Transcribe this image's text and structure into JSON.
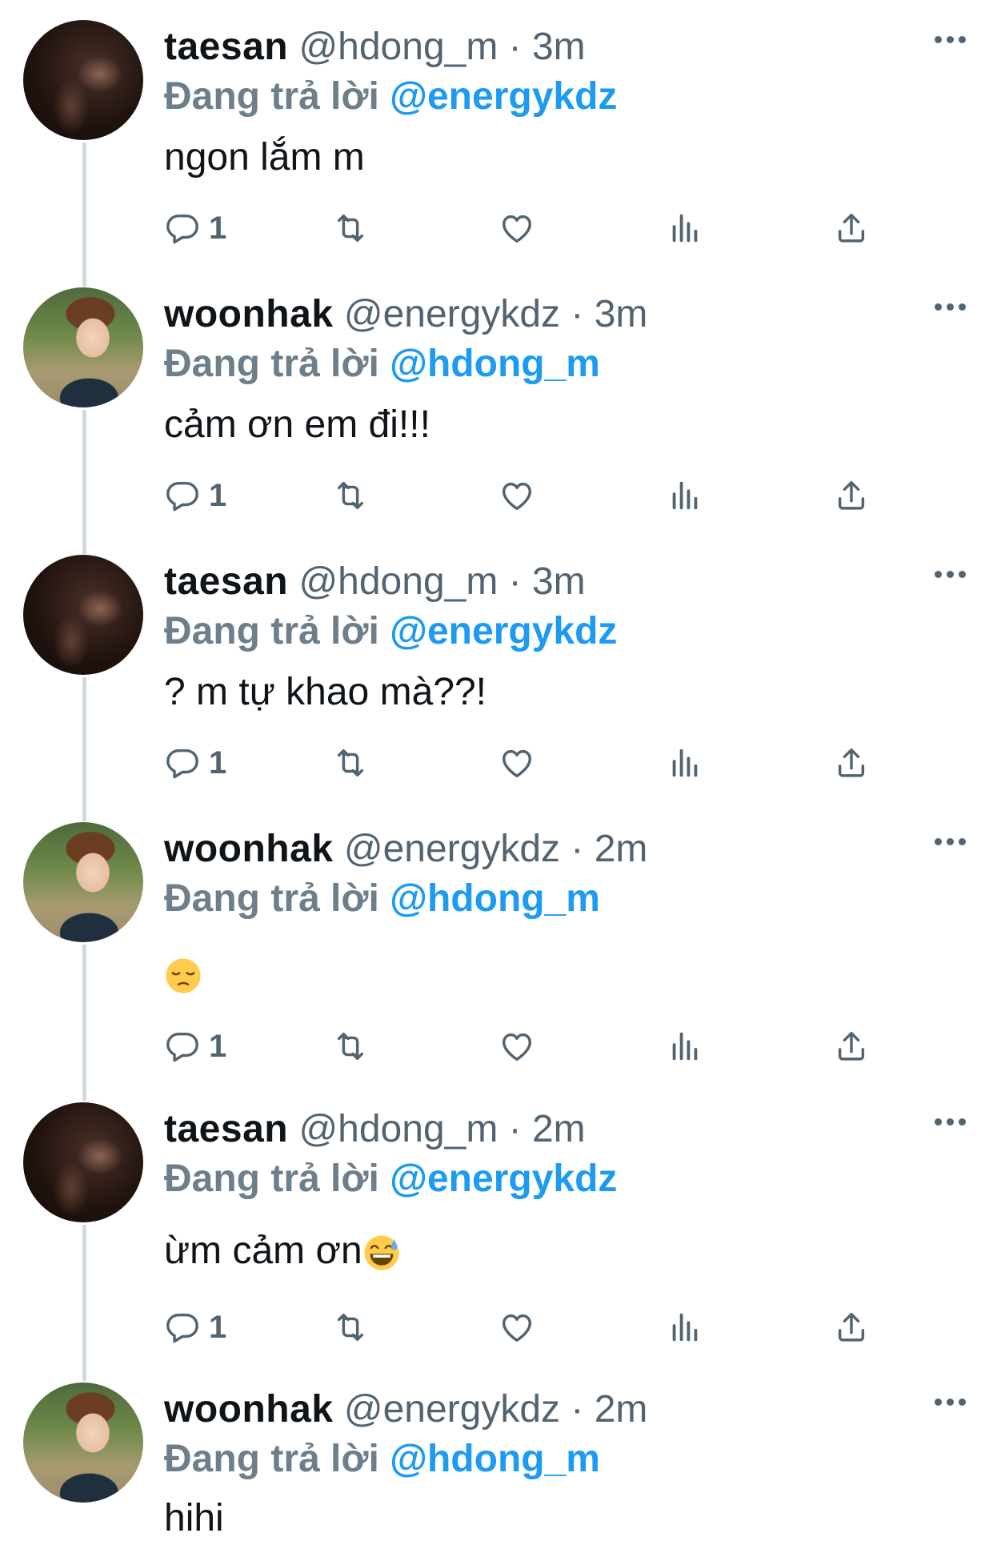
{
  "replying_prefix": "Đang trả lời",
  "tweets": [
    {
      "name": "taesan",
      "handle": "@hdong_m · 3m",
      "reply_to": "@energykdz",
      "text": "ngon lắm m",
      "reply_count": "1",
      "avatar": "dark-selfie"
    },
    {
      "name": "woonhak",
      "handle": "@energykdz · 3m",
      "reply_to": "@hdong_m",
      "text": "cảm ơn em đi!!!",
      "reply_count": "1",
      "avatar": "outdoor-selfie"
    },
    {
      "name": "taesan",
      "handle": "@hdong_m · 3m",
      "reply_to": "@energykdz",
      "text": "? m tự khao mà??!",
      "reply_count": "1",
      "avatar": "dark-selfie"
    },
    {
      "name": "woonhak",
      "handle": "@energykdz · 2m",
      "reply_to": "@hdong_m",
      "text": "",
      "emoji": "pensive-face",
      "reply_count": "1",
      "avatar": "outdoor-selfie"
    },
    {
      "name": "taesan",
      "handle": "@hdong_m · 2m",
      "reply_to": "@energykdz",
      "text": "ừm cảm ơn",
      "emoji": "grinning-sweat-face",
      "reply_count": "1",
      "avatar": "dark-selfie"
    },
    {
      "name": "woonhak",
      "handle": "@energykdz · 2m",
      "reply_to": "@hdong_m",
      "text": "hihi",
      "avatar": "outdoor-selfie"
    }
  ],
  "icons": [
    "reply-icon",
    "retweet-icon",
    "like-icon",
    "views-icon",
    "share-icon",
    "more-icon"
  ],
  "colors": {
    "link": "#1d9bf0",
    "secondary": "#536471",
    "thread_line": "#cfd9de"
  }
}
